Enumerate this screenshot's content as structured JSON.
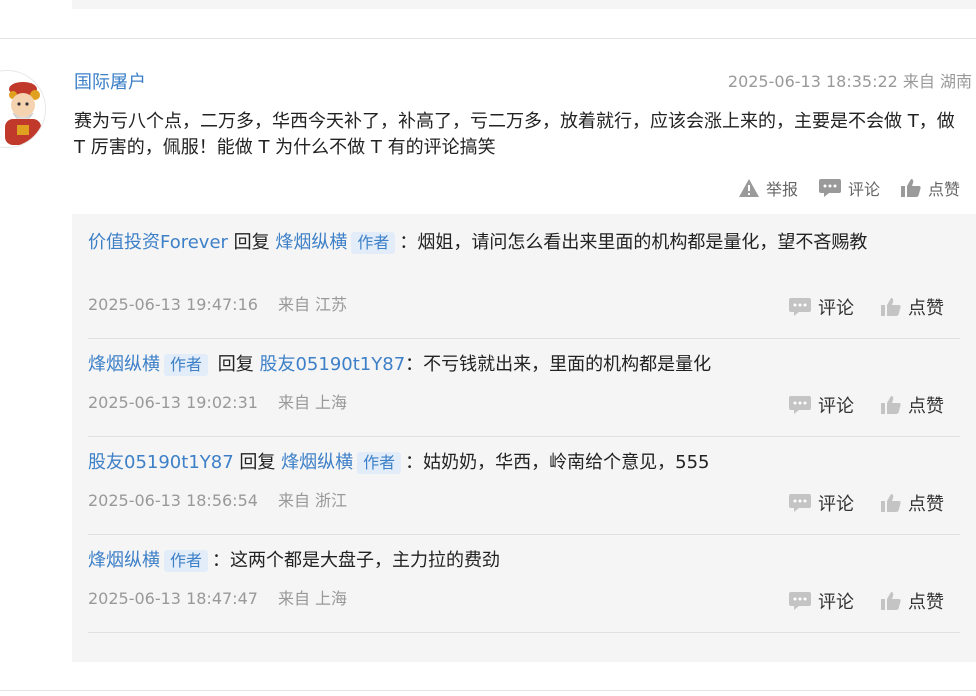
{
  "comment": {
    "username": "国际屠户",
    "time": "2025-06-13 18:35:22 来自 湖南",
    "text": "赛为亏八个点，二万多，华西今天补了，补高了，亏二万多，放着就行，应该会涨上来的，主要是不会做 T，做 T 厉害的，佩服！能做 T 为什么不做 T 有的评论搞笑",
    "actions": {
      "report": "举报",
      "comment": "评论",
      "like": "点赞"
    }
  },
  "reply_word": "回复",
  "author_tag": "作者",
  "replies": [
    {
      "user": "价值投资Forever",
      "target": "烽烟纵横",
      "target_author": true,
      "text": "：烟姐，请问怎么看出来里面的机构都是量化，望不吝赐教",
      "time": "2025-06-13 19:47:16",
      "loc": "来自 江苏",
      "comment": "评论",
      "like": "点赞"
    },
    {
      "user": "烽烟纵横",
      "user_author": true,
      "target": "股友05190t1Y87",
      "text": "：不亏钱就出来，里面的机构都是量化",
      "time": "2025-06-13 19:02:31",
      "loc": "来自 上海",
      "comment": "评论",
      "like": "点赞"
    },
    {
      "user": "股友05190t1Y87",
      "target": "烽烟纵横",
      "target_author": true,
      "text": "：姑奶奶，华西，岭南给个意见，555",
      "time": "2025-06-13 18:56:54",
      "loc": "来自 浙江",
      "comment": "评论",
      "like": "点赞"
    },
    {
      "user": "烽烟纵横",
      "user_author": true,
      "text": "：这两个都是大盘子，主力拉的费劲",
      "time": "2025-06-13 18:47:47",
      "loc": "来自 上海",
      "comment": "评论",
      "like": "点赞"
    }
  ]
}
